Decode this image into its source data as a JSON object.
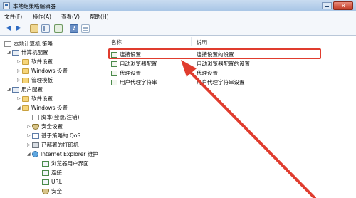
{
  "window": {
    "title": "本地组策略编辑器"
  },
  "menu": {
    "file": "文件(F)",
    "action": "操作(A)",
    "view": "查看(V)",
    "help": "帮助(H)"
  },
  "tree": {
    "root": "本地计算机 策略",
    "computer_config": "计算机配置",
    "software_settings_1": "软件设置",
    "windows_settings_1": "Windows 设置",
    "admin_templates": "管理模板",
    "user_config": "用户配置",
    "software_settings_2": "软件设置",
    "windows_settings_2": "Windows 设置",
    "scripts": "脚本(登录/注销)",
    "security_settings": "安全设置",
    "policy_qos": "基于策略的 QoS",
    "deployed_printers": "已部署的打印机",
    "ie_maintenance": "Internet Explorer 维护",
    "browser_ui": "浏览器用户界面",
    "connection": "连接",
    "url": "URL",
    "security": "安全"
  },
  "list": {
    "header_name": "名称",
    "header_desc": "说明",
    "rows": [
      {
        "name": "连接设置",
        "desc": "连接设置的设置"
      },
      {
        "name": "自动浏览器配置",
        "desc": "自动浏览器配置的设置"
      },
      {
        "name": "代理设置",
        "desc": "代理设置"
      },
      {
        "name": "用户代理字符串",
        "desc": "用户代理字符串设置"
      }
    ]
  },
  "colors": {
    "annotation": "#e03c2e"
  }
}
